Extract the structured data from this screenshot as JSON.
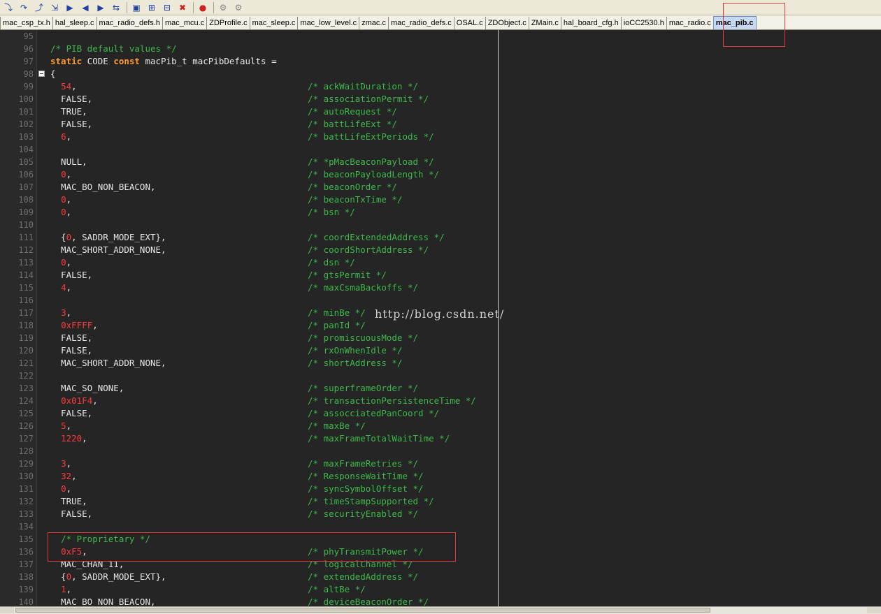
{
  "toolbar": {
    "buttons": [
      {
        "name": "step-into-icon",
        "glyph": "⤵"
      },
      {
        "name": "step-over-icon",
        "glyph": "↷"
      },
      {
        "name": "step-out-icon",
        "glyph": "⤴"
      },
      {
        "name": "run-to-cursor-icon",
        "glyph": "⇲"
      },
      {
        "name": "next-statement-icon",
        "glyph": "▶"
      },
      {
        "name": "back-icon",
        "glyph": "◀"
      },
      {
        "name": "forward-icon",
        "glyph": "▶"
      },
      {
        "name": "source-nav-icon",
        "glyph": "⇆"
      },
      {
        "name": "bookmark-icon",
        "glyph": "▣"
      },
      {
        "name": "toggle-breakpoint-icon",
        "glyph": "⊞"
      },
      {
        "name": "enable-breakpoint-icon",
        "glyph": "⊟"
      },
      {
        "name": "clear-breakpoints-icon",
        "glyph": "✖"
      },
      {
        "name": "stop-icon",
        "glyph": "●"
      },
      {
        "name": "make-icon",
        "glyph": "⚙"
      },
      {
        "name": "debug-icon",
        "glyph": "⚙"
      }
    ]
  },
  "tabs": [
    {
      "label": "mac_csp_tx.h"
    },
    {
      "label": "hal_sleep.c"
    },
    {
      "label": "mac_radio_defs.h"
    },
    {
      "label": "mac_mcu.c"
    },
    {
      "label": "ZDProfile.c"
    },
    {
      "label": "mac_sleep.c"
    },
    {
      "label": "mac_low_level.c"
    },
    {
      "label": "zmac.c"
    },
    {
      "label": "mac_radio_defs.c"
    },
    {
      "label": "OSAL.c"
    },
    {
      "label": "ZDObject.c"
    },
    {
      "label": "ZMain.c"
    },
    {
      "label": "hal_board_cfg.h"
    },
    {
      "label": "ioCC2530.h"
    },
    {
      "label": "mac_radio.c"
    },
    {
      "label": "mac_pib.c",
      "active": true
    }
  ],
  "editor": {
    "watermark": "http://blog.csdn.net/",
    "lines": [
      {
        "n": "95",
        "code": "",
        "comment": ""
      },
      {
        "n": "96",
        "code": "",
        "comment": "",
        "full_comment": "/* PIB default values */"
      },
      {
        "n": "97",
        "code": "static CODE const macPib_t macPibDefaults =",
        "comment": "",
        "kw": true
      },
      {
        "n": "98",
        "code": "{",
        "comment": "",
        "fold": true
      },
      {
        "n": "99",
        "code": "  54,",
        "comment": "/* ackWaitDuration */",
        "num": "54"
      },
      {
        "n": "100",
        "code": "  FALSE,",
        "comment": "/* associationPermit */"
      },
      {
        "n": "101",
        "code": "  TRUE,",
        "comment": "/* autoRequest */"
      },
      {
        "n": "102",
        "code": "  FALSE,",
        "comment": "/* battLifeExt */"
      },
      {
        "n": "103",
        "code": "  6,",
        "comment": "/* battLifeExtPeriods */",
        "num": "6"
      },
      {
        "n": "104",
        "code": "",
        "comment": ""
      },
      {
        "n": "105",
        "code": "  NULL,",
        "comment": "/* *pMacBeaconPayload */"
      },
      {
        "n": "106",
        "code": "  0,",
        "comment": "/* beaconPayloadLength */",
        "num": "0"
      },
      {
        "n": "107",
        "code": "  MAC_BO_NON_BEACON,",
        "comment": "/* beaconOrder */"
      },
      {
        "n": "108",
        "code": "  0,",
        "comment": "/* beaconTxTime */",
        "num": "0"
      },
      {
        "n": "109",
        "code": "  0,",
        "comment": "/* bsn */",
        "num": "0"
      },
      {
        "n": "110",
        "code": "",
        "comment": ""
      },
      {
        "n": "111",
        "code": "  {0, SADDR_MODE_EXT},",
        "comment": "/* coordExtendedAddress */",
        "brace_num": "0"
      },
      {
        "n": "112",
        "code": "  MAC_SHORT_ADDR_NONE,",
        "comment": "/* coordShortAddress */"
      },
      {
        "n": "113",
        "code": "  0,",
        "comment": "/* dsn */",
        "num": "0"
      },
      {
        "n": "114",
        "code": "  FALSE,",
        "comment": "/* gtsPermit */"
      },
      {
        "n": "115",
        "code": "  4,",
        "comment": "/* maxCsmaBackoffs */",
        "num": "4"
      },
      {
        "n": "116",
        "code": "",
        "comment": ""
      },
      {
        "n": "117",
        "code": "  3,",
        "comment": "/* minBe */",
        "num": "3"
      },
      {
        "n": "118",
        "code": "  0xFFFF,",
        "comment": "/* panId */",
        "num": "0xFFFF"
      },
      {
        "n": "119",
        "code": "  FALSE,",
        "comment": "/* promiscuousMode */"
      },
      {
        "n": "120",
        "code": "  FALSE,",
        "comment": "/* rxOnWhenIdle */"
      },
      {
        "n": "121",
        "code": "  MAC_SHORT_ADDR_NONE,",
        "comment": "/* shortAddress */"
      },
      {
        "n": "122",
        "code": "",
        "comment": ""
      },
      {
        "n": "123",
        "code": "  MAC_SO_NONE,",
        "comment": "/* superframeOrder */"
      },
      {
        "n": "124",
        "code": "  0x01F4,",
        "comment": "/* transactionPersistenceTime */",
        "num": "0x01F4"
      },
      {
        "n": "125",
        "code": "  FALSE,",
        "comment": "/* assocciatedPanCoord */"
      },
      {
        "n": "126",
        "code": "  5,",
        "comment": "/* maxBe */",
        "num": "5"
      },
      {
        "n": "127",
        "code": "  1220,",
        "comment": "/* maxFrameTotalWaitTime */",
        "num": "1220"
      },
      {
        "n": "128",
        "code": "",
        "comment": ""
      },
      {
        "n": "129",
        "code": "  3,",
        "comment": "/* maxFrameRetries */",
        "num": "3"
      },
      {
        "n": "130",
        "code": "  32,",
        "comment": "/* ResponseWaitTime */",
        "num": "32"
      },
      {
        "n": "131",
        "code": "  0,",
        "comment": "/* syncSymbolOffset */",
        "num": "0"
      },
      {
        "n": "132",
        "code": "  TRUE,",
        "comment": "/* timeStampSupported */"
      },
      {
        "n": "133",
        "code": "  FALSE,",
        "comment": "/* securityEnabled */"
      },
      {
        "n": "134",
        "code": "",
        "comment": ""
      },
      {
        "n": "135",
        "code": "",
        "comment": "",
        "full_comment": "  /* Proprietary */"
      },
      {
        "n": "136",
        "code": "  0xF5,",
        "comment": "/* phyTransmitPower */",
        "num": "0xF5"
      },
      {
        "n": "137",
        "code": "  MAC_CHAN_11,",
        "comment": "/* logicalChannel */"
      },
      {
        "n": "138",
        "code": "  {0, SADDR_MODE_EXT},",
        "comment": "/* extendedAddress */",
        "brace_num": "0"
      },
      {
        "n": "139",
        "code": "  1,",
        "comment": "/* altBe */",
        "num": "1"
      },
      {
        "n": "140",
        "code": "  MAC_BO_NON_BEACON,",
        "comment": "/* deviceBeaconOrder */"
      }
    ]
  }
}
